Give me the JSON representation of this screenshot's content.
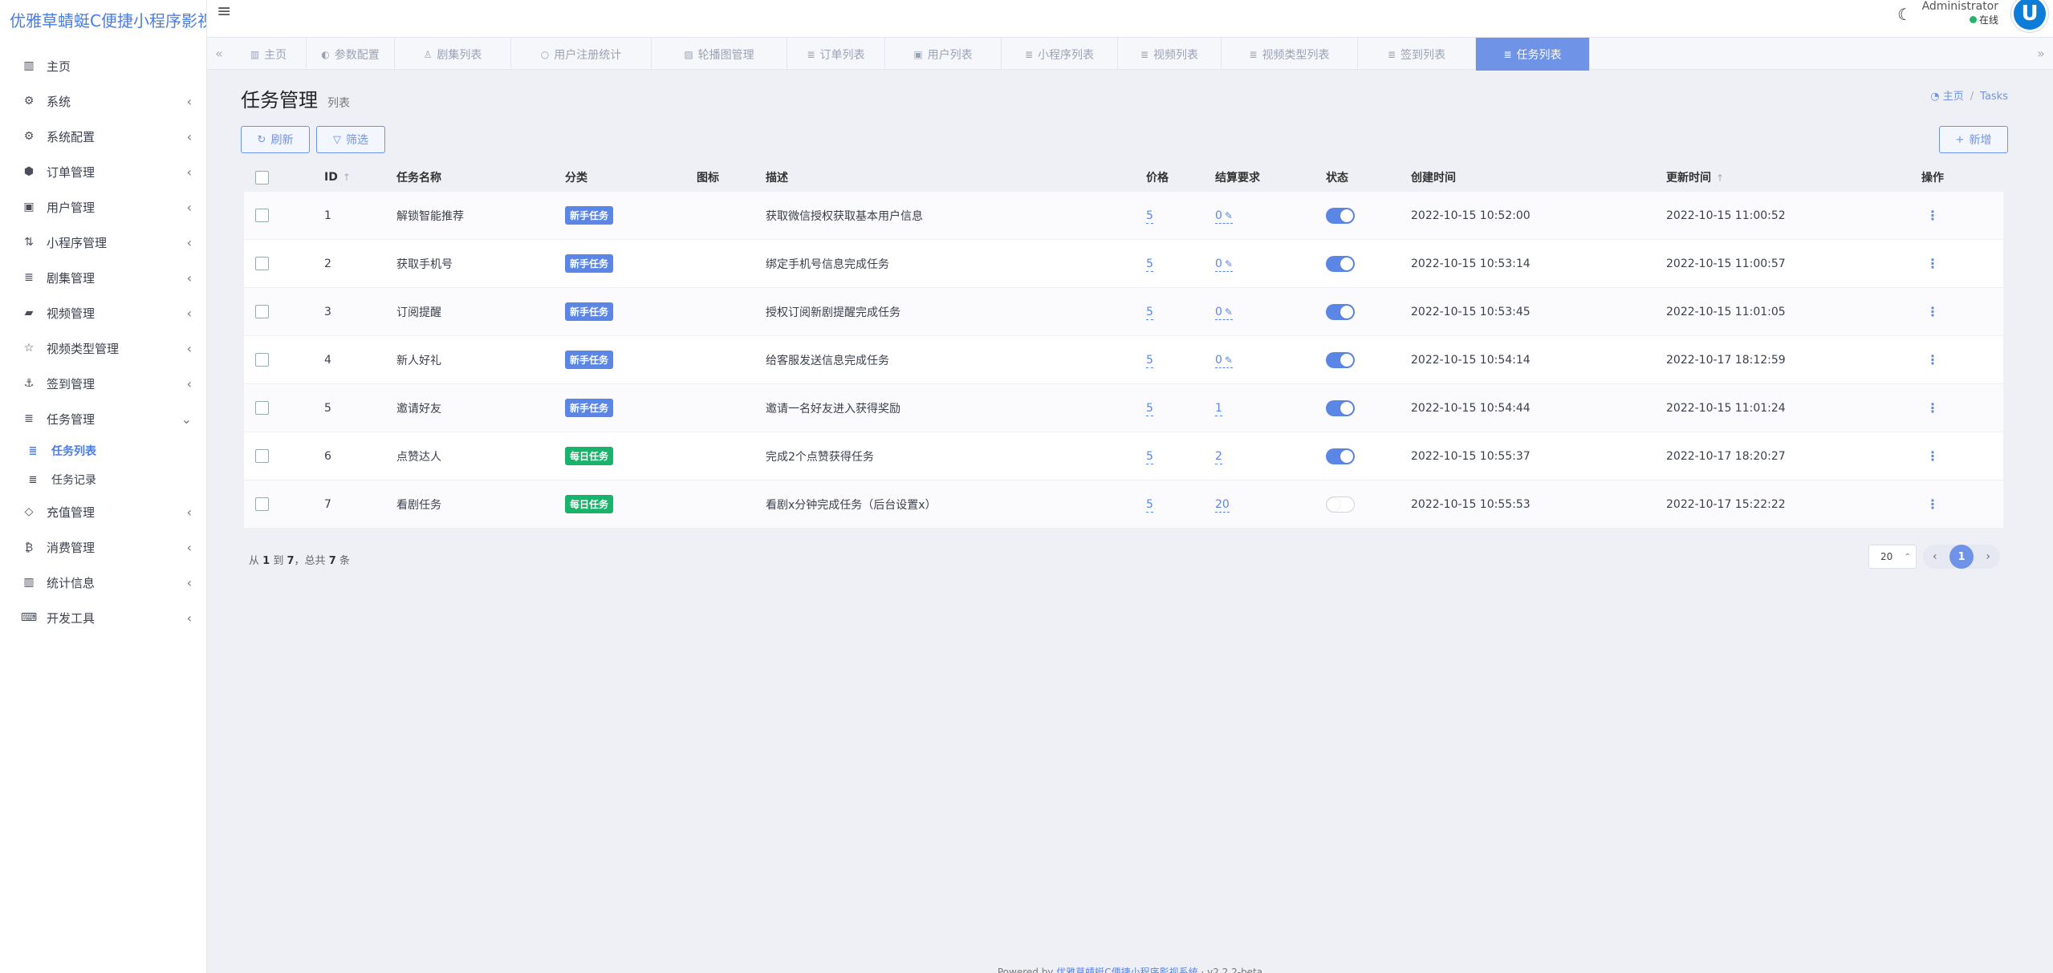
{
  "app": {
    "brand": "优雅草蜻蜓C便捷小程序影视",
    "user_name": "Administrator",
    "user_status": "在线",
    "avatar_letter": "U"
  },
  "sidebar": {
    "items": [
      {
        "label": "主页",
        "icon": "dashboard-icon",
        "glyph": "▥",
        "arrow": ""
      },
      {
        "label": "系统",
        "icon": "gear-icon",
        "glyph": "⚙",
        "arrow": "‹"
      },
      {
        "label": "系统配置",
        "icon": "cogs-icon",
        "glyph": "⚙",
        "arrow": "‹"
      },
      {
        "label": "订单管理",
        "icon": "cube-icon",
        "glyph": "⬢",
        "arrow": "‹"
      },
      {
        "label": "用户管理",
        "icon": "address-book-icon",
        "glyph": "▣",
        "arrow": "‹"
      },
      {
        "label": "小程序管理",
        "icon": "sort-icon",
        "glyph": "⇅",
        "arrow": "‹"
      },
      {
        "label": "剧集管理",
        "icon": "list-icon",
        "glyph": "≣",
        "arrow": "‹"
      },
      {
        "label": "视频管理",
        "icon": "video-icon",
        "glyph": "▰",
        "arrow": "‹"
      },
      {
        "label": "视频类型管理",
        "icon": "star-icon",
        "glyph": "☆",
        "arrow": "‹"
      },
      {
        "label": "签到管理",
        "icon": "anchor-icon",
        "glyph": "⚓",
        "arrow": "‹"
      },
      {
        "label": "任务管理",
        "icon": "tasks-icon",
        "glyph": "≣",
        "arrow": "⌄"
      }
    ],
    "sub_items": [
      {
        "label": "任务列表",
        "icon": "list-icon",
        "glyph": "≣"
      },
      {
        "label": "任务记录",
        "icon": "list-icon",
        "glyph": "≣"
      }
    ],
    "items_after": [
      {
        "label": "充值管理",
        "icon": "diamond-icon",
        "glyph": "◇",
        "arrow": "‹"
      },
      {
        "label": "消费管理",
        "icon": "bitcoin-icon",
        "glyph": "₿",
        "arrow": "‹"
      },
      {
        "label": "统计信息",
        "icon": "bar-chart-icon",
        "glyph": "▥",
        "arrow": "‹"
      },
      {
        "label": "开发工具",
        "icon": "keyboard-icon",
        "glyph": "⌨",
        "arrow": "‹"
      }
    ]
  },
  "tabs": [
    {
      "label": "主页",
      "icon": "dashboard-icon",
      "glyph": "▥",
      "active": false
    },
    {
      "label": "参数配置",
      "icon": "toggle-icon",
      "glyph": "◐",
      "active": false
    },
    {
      "label": "剧集列表",
      "icon": "users-icon",
      "glyph": "♙",
      "active": false
    },
    {
      "label": "用户注册统计",
      "icon": "circle-icon",
      "glyph": "○",
      "active": false
    },
    {
      "label": "轮播图管理",
      "icon": "image-icon",
      "glyph": "▨",
      "active": false
    },
    {
      "label": "订单列表",
      "icon": "list-icon",
      "glyph": "≣",
      "active": false
    },
    {
      "label": "用户列表",
      "icon": "user-card-icon",
      "glyph": "▣",
      "active": false
    },
    {
      "label": "小程序列表",
      "icon": "list-icon",
      "glyph": "≣",
      "active": false
    },
    {
      "label": "视频列表",
      "icon": "list-icon",
      "glyph": "≣",
      "active": false
    },
    {
      "label": "视频类型列表",
      "icon": "list-icon",
      "glyph": "≣",
      "active": false
    },
    {
      "label": "签到列表",
      "icon": "list-icon",
      "glyph": "≣",
      "active": false
    },
    {
      "label": "任务列表",
      "icon": "list-icon",
      "glyph": "≣",
      "active": true
    }
  ],
  "page": {
    "title": "任务管理",
    "subtitle": "列表",
    "breadcrumb_home": "主页",
    "breadcrumb_current": "Tasks"
  },
  "toolbar": {
    "refresh_label": "刷新",
    "filter_label": "筛选",
    "new_label": "新增"
  },
  "table": {
    "headers": {
      "id": "ID",
      "name": "任务名称",
      "category": "分类",
      "icon": "图标",
      "desc": "描述",
      "price": "价格",
      "requirement": "结算要求",
      "status": "状态",
      "created": "创建时间",
      "updated": "更新时间",
      "ops": "操作"
    },
    "rows": [
      {
        "id": "1",
        "name": "解锁智能推荐",
        "category": "新手任务",
        "cat_color": "blue",
        "desc": "获取微信授权获取基本用户信息",
        "price": "5",
        "requirement": "0",
        "req_pencil": true,
        "status": true,
        "created": "2022-10-15 10:52:00",
        "updated": "2022-10-15 11:00:52"
      },
      {
        "id": "2",
        "name": "获取手机号",
        "category": "新手任务",
        "cat_color": "blue",
        "desc": "绑定手机号信息完成任务",
        "price": "5",
        "requirement": "0",
        "req_pencil": true,
        "status": true,
        "created": "2022-10-15 10:53:14",
        "updated": "2022-10-15 11:00:57"
      },
      {
        "id": "3",
        "name": "订阅提醒",
        "category": "新手任务",
        "cat_color": "blue",
        "desc": "授权订阅新剧提醒完成任务",
        "price": "5",
        "requirement": "0",
        "req_pencil": true,
        "status": true,
        "created": "2022-10-15 10:53:45",
        "updated": "2022-10-15 11:01:05"
      },
      {
        "id": "4",
        "name": "新人好礼",
        "category": "新手任务",
        "cat_color": "blue",
        "desc": "给客服发送信息完成任务",
        "price": "5",
        "requirement": "0",
        "req_pencil": true,
        "status": true,
        "created": "2022-10-15 10:54:14",
        "updated": "2022-10-17 18:12:59"
      },
      {
        "id": "5",
        "name": "邀请好友",
        "category": "新手任务",
        "cat_color": "blue",
        "desc": "邀请一名好友进入获得奖励",
        "price": "5",
        "requirement": "1",
        "req_pencil": false,
        "status": true,
        "created": "2022-10-15 10:54:44",
        "updated": "2022-10-15 11:01:24"
      },
      {
        "id": "6",
        "name": "点赞达人",
        "category": "每日任务",
        "cat_color": "green",
        "desc": "完成2个点赞获得任务",
        "price": "5",
        "requirement": "2",
        "req_pencil": false,
        "status": true,
        "created": "2022-10-15 10:55:37",
        "updated": "2022-10-17 18:20:27"
      },
      {
        "id": "7",
        "name": "看剧任务",
        "category": "每日任务",
        "cat_color": "green",
        "desc": "看剧x分钟完成任务（后台设置x）",
        "price": "5",
        "requirement": "20",
        "req_pencil": false,
        "status": false,
        "created": "2022-10-15 10:55:53",
        "updated": "2022-10-17 15:22:22"
      }
    ]
  },
  "pagination": {
    "from_label": "从",
    "from": "1",
    "to_label": "到",
    "to": "7",
    "total_label": "，总共",
    "total": "7",
    "unit": "条",
    "page_size": "20",
    "current_page": "1"
  },
  "footer": {
    "prefix": "Powered by",
    "link": "优雅草蜻蜓C便捷小程序影视系统",
    "version": "· v2.2.2-beta"
  },
  "colors": {
    "accent": "#6f93e6",
    "brand": "#4a7ce8",
    "badge_new": "#5b86e5",
    "badge_daily": "#19b36b",
    "online": "#2ab26b"
  }
}
